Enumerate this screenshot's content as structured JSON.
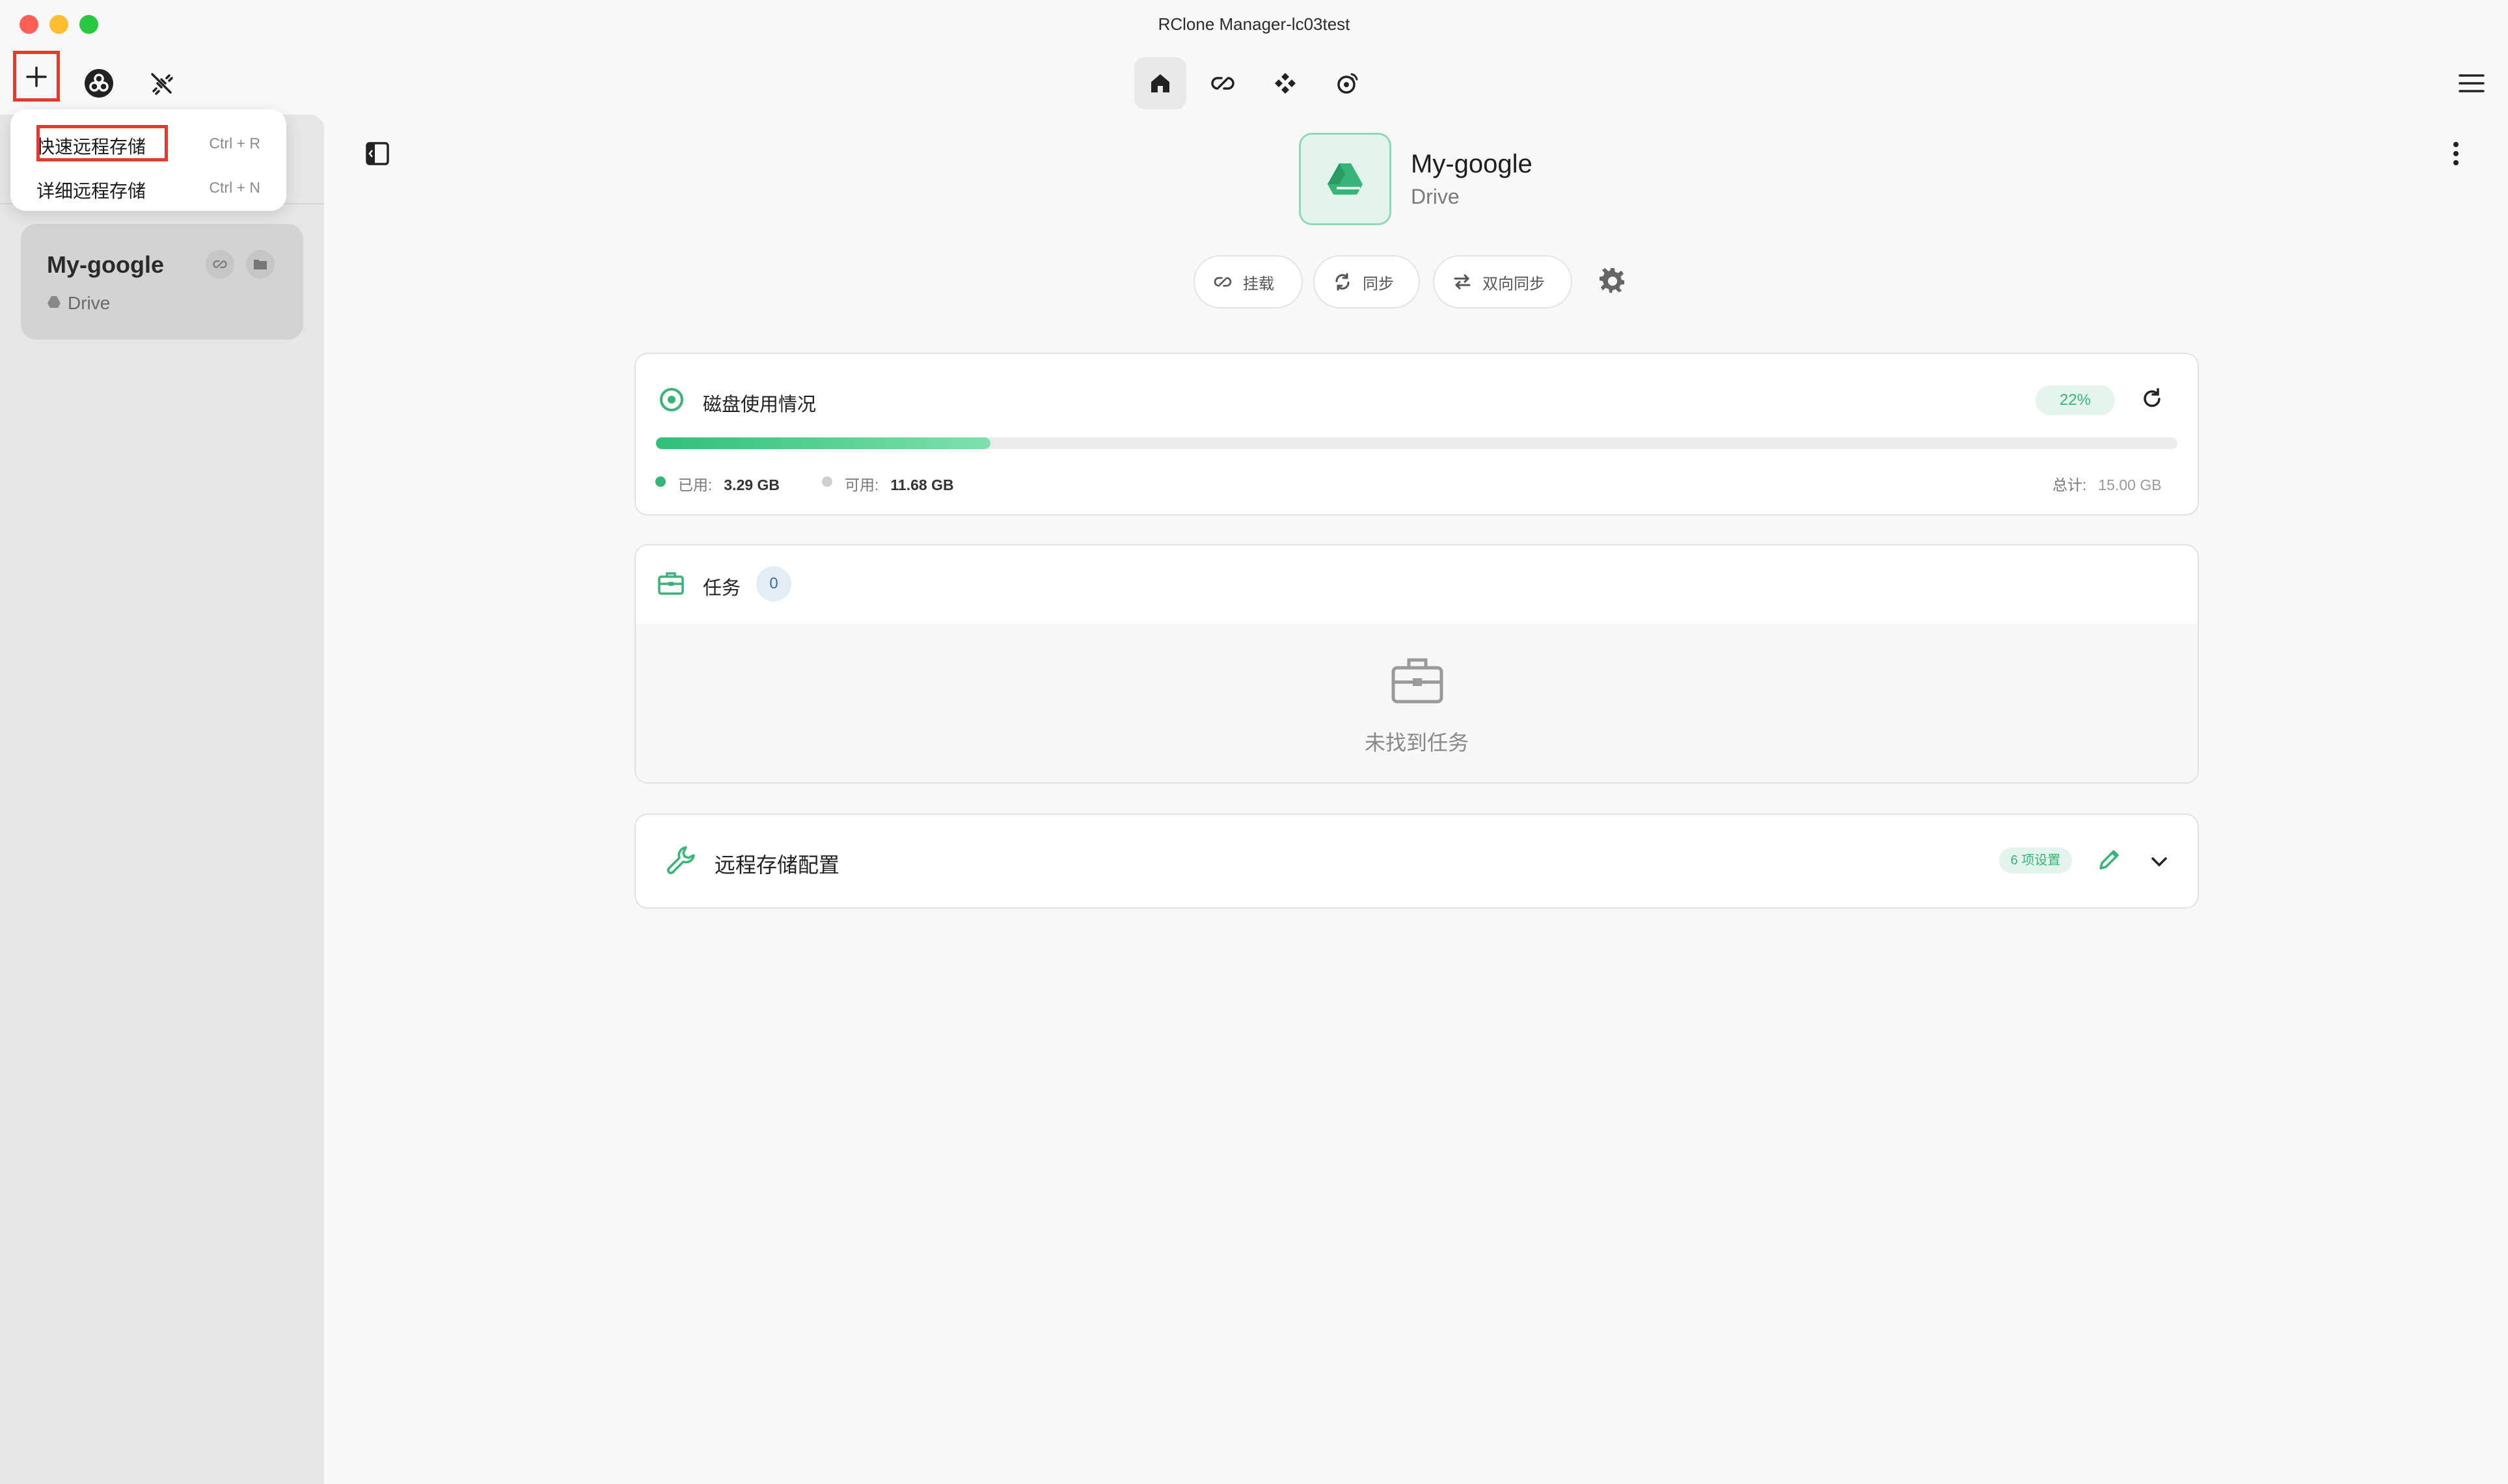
{
  "window": {
    "title": "RClone Manager-lc03test",
    "traffic_colors": [
      "#ff5f57",
      "#febc2e",
      "#28c840"
    ]
  },
  "toolbar": {
    "left_icons": [
      "plus-icon",
      "rclone-logo-icon",
      "disconnect-icon"
    ],
    "nav_icons": [
      "home-icon",
      "mount-icon",
      "sync-icon",
      "serve-icon"
    ],
    "menu_icon": "hamburger-menu-icon"
  },
  "dropdown": {
    "items": [
      {
        "label": "快速远程存储",
        "shortcut": "Ctrl + R"
      },
      {
        "label": "详细远程存储",
        "shortcut": "Ctrl + N"
      }
    ]
  },
  "sidebar": {
    "remote": {
      "name": "My-google",
      "type": "Drive"
    }
  },
  "remote": {
    "name": "My-google",
    "type": "Drive",
    "accent": "#37b578",
    "actions": [
      "挂载",
      "同步",
      "双向同步"
    ]
  },
  "disk": {
    "title": "磁盘使用情况",
    "percent_label": "22%",
    "used_fraction": 0.22,
    "used_label": "已用:",
    "used_value": "3.29 GB",
    "free_label": "可用:",
    "free_value": "11.68 GB",
    "total_label": "总计:",
    "total_value": "15.00 GB"
  },
  "tasks": {
    "title": "任务",
    "count": "0",
    "empty_text": "未找到任务"
  },
  "config": {
    "title": "远程存储配置",
    "badge": "6 项设置"
  }
}
